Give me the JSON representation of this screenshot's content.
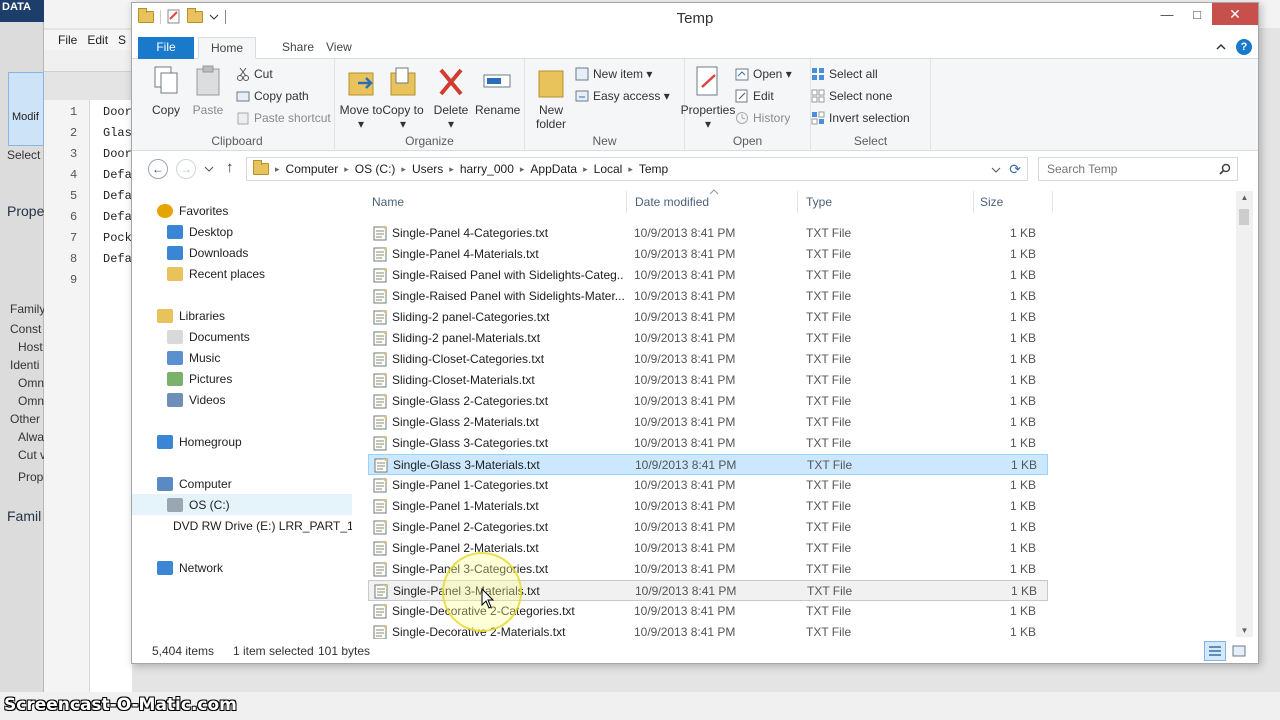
{
  "background_app": {
    "brand": "DATA",
    "menu": [
      "File",
      "Edit",
      "S"
    ],
    "modify_label": "Modif",
    "select_label": "Select",
    "properties_label": "Prope",
    "family_label": "Family",
    "side_items": [
      "Const",
      "Host",
      "Identi",
      "Omn",
      "Omn",
      "Other",
      "Alwa",
      "Cut v",
      "Prope"
    ],
    "family2_label": "Famil",
    "editor_lines": [
      {
        "num": "1",
        "text": "Door"
      },
      {
        "num": "2",
        "text": "Glas"
      },
      {
        "num": "3",
        "text": "Door"
      },
      {
        "num": "4",
        "text": "Defa"
      },
      {
        "num": "5",
        "text": "Defa"
      },
      {
        "num": "6",
        "text": "Defa"
      },
      {
        "num": "7",
        "text": "Pock"
      },
      {
        "num": "8",
        "text": "Defa"
      },
      {
        "num": "9",
        "text": ""
      }
    ],
    "watermark": "Screencast-O-Matic.com"
  },
  "window": {
    "title": "Temp",
    "minimize": "—",
    "maximize": "□",
    "close": "✕"
  },
  "ribbon_tabs": {
    "file": "File",
    "home": "Home",
    "share": "Share",
    "view": "View"
  },
  "ribbon": {
    "clipboard": {
      "label": "Clipboard",
      "copy": "Copy",
      "paste": "Paste",
      "cut": "Cut",
      "copy_path": "Copy path",
      "paste_shortcut": "Paste shortcut"
    },
    "organize": {
      "label": "Organize",
      "move_to": "Move to ▾",
      "copy_to": "Copy to ▾",
      "delete": "Delete ▾",
      "rename": "Rename"
    },
    "new": {
      "label": "New",
      "new_folder": "New folder",
      "new_item": "New item ▾",
      "easy_access": "Easy access ▾"
    },
    "open": {
      "label": "Open",
      "properties": "Properties ▾",
      "open": "Open ▾",
      "edit": "Edit",
      "history": "History"
    },
    "select": {
      "label": "Select",
      "select_all": "Select all",
      "select_none": "Select none",
      "invert_selection": "Invert selection"
    }
  },
  "address": {
    "crumbs": [
      "Computer",
      "OS (C:)",
      "Users",
      "harry_000",
      "AppData",
      "Local",
      "Temp"
    ],
    "search_placeholder": "Search Temp"
  },
  "nav_pane": [
    {
      "label": "Favorites",
      "indent": 0,
      "icon": "star-icon"
    },
    {
      "label": "Desktop",
      "indent": 1,
      "icon": "desktop-icon"
    },
    {
      "label": "Downloads",
      "indent": 1,
      "icon": "downloads-icon"
    },
    {
      "label": "Recent places",
      "indent": 1,
      "icon": "recent-places-icon"
    },
    {
      "label": "Libraries",
      "indent": 0,
      "icon": "libraries-icon"
    },
    {
      "label": "Documents",
      "indent": 1,
      "icon": "documents-icon"
    },
    {
      "label": "Music",
      "indent": 1,
      "icon": "music-icon"
    },
    {
      "label": "Pictures",
      "indent": 1,
      "icon": "pictures-icon"
    },
    {
      "label": "Videos",
      "indent": 1,
      "icon": "videos-icon"
    },
    {
      "label": "Homegroup",
      "indent": 0,
      "icon": "homegroup-icon"
    },
    {
      "label": "Computer",
      "indent": 0,
      "icon": "computer-icon"
    },
    {
      "label": "OS (C:)",
      "indent": 1,
      "icon": "drive-icon",
      "selected": true
    },
    {
      "label": "DVD RW Drive (E:) LRR_PART_1",
      "indent": 1,
      "icon": "dvd-drive-icon"
    },
    {
      "label": "Network",
      "indent": 0,
      "icon": "network-icon"
    }
  ],
  "columns": {
    "name": "Name",
    "date": "Date modified",
    "type": "Type",
    "size": "Size"
  },
  "files": [
    {
      "name": "Single-Panel 4-Categories.txt",
      "date": "10/9/2013 8:41 PM",
      "type": "TXT File",
      "size": "1 KB"
    },
    {
      "name": "Single-Panel 4-Materials.txt",
      "date": "10/9/2013 8:41 PM",
      "type": "TXT File",
      "size": "1 KB"
    },
    {
      "name": "Single-Raised Panel with Sidelights-Categ...",
      "date": "10/9/2013 8:41 PM",
      "type": "TXT File",
      "size": "1 KB"
    },
    {
      "name": "Single-Raised Panel with Sidelights-Mater...",
      "date": "10/9/2013 8:41 PM",
      "type": "TXT File",
      "size": "1 KB"
    },
    {
      "name": "Sliding-2 panel-Categories.txt",
      "date": "10/9/2013 8:41 PM",
      "type": "TXT File",
      "size": "1 KB"
    },
    {
      "name": "Sliding-2 panel-Materials.txt",
      "date": "10/9/2013 8:41 PM",
      "type": "TXT File",
      "size": "1 KB"
    },
    {
      "name": "Sliding-Closet-Categories.txt",
      "date": "10/9/2013 8:41 PM",
      "type": "TXT File",
      "size": "1 KB"
    },
    {
      "name": "Sliding-Closet-Materials.txt",
      "date": "10/9/2013 8:41 PM",
      "type": "TXT File",
      "size": "1 KB"
    },
    {
      "name": "Single-Glass 2-Categories.txt",
      "date": "10/9/2013 8:41 PM",
      "type": "TXT File",
      "size": "1 KB"
    },
    {
      "name": "Single-Glass 2-Materials.txt",
      "date": "10/9/2013 8:41 PM",
      "type": "TXT File",
      "size": "1 KB"
    },
    {
      "name": "Single-Glass 3-Categories.txt",
      "date": "10/9/2013 8:41 PM",
      "type": "TXT File",
      "size": "1 KB"
    },
    {
      "name": "Single-Glass 3-Materials.txt",
      "date": "10/9/2013 8:41 PM",
      "type": "TXT File",
      "size": "1 KB",
      "state": "selected"
    },
    {
      "name": "Single-Panel 1-Categories.txt",
      "date": "10/9/2013 8:41 PM",
      "type": "TXT File",
      "size": "1 KB"
    },
    {
      "name": "Single-Panel 1-Materials.txt",
      "date": "10/9/2013 8:41 PM",
      "type": "TXT File",
      "size": "1 KB"
    },
    {
      "name": "Single-Panel 2-Categories.txt",
      "date": "10/9/2013 8:41 PM",
      "type": "TXT File",
      "size": "1 KB"
    },
    {
      "name": "Single-Panel 2-Materials.txt",
      "date": "10/9/2013 8:41 PM",
      "type": "TXT File",
      "size": "1 KB"
    },
    {
      "name": "Single-Panel 3-Categories.txt",
      "date": "10/9/2013 8:41 PM",
      "type": "TXT File",
      "size": "1 KB"
    },
    {
      "name": "Single-Panel 3-Materials.txt",
      "date": "10/9/2013 8:41 PM",
      "type": "TXT File",
      "size": "1 KB",
      "state": "hover"
    },
    {
      "name": "Single-Decorative 2-Categories.txt",
      "date": "10/9/2013 8:41 PM",
      "type": "TXT File",
      "size": "1 KB"
    },
    {
      "name": "Single-Decorative 2-Materials.txt",
      "date": "10/9/2013 8:41 PM",
      "type": "TXT File",
      "size": "1 KB"
    }
  ],
  "status": {
    "item_count": "5,404 items",
    "selection": "1 item selected",
    "bytes": "101 bytes"
  },
  "colors": {
    "accent": "#1979ca",
    "selection_bg": "#cce8ff",
    "selection_border": "#99d1ff",
    "close_button": "#c7504d"
  }
}
